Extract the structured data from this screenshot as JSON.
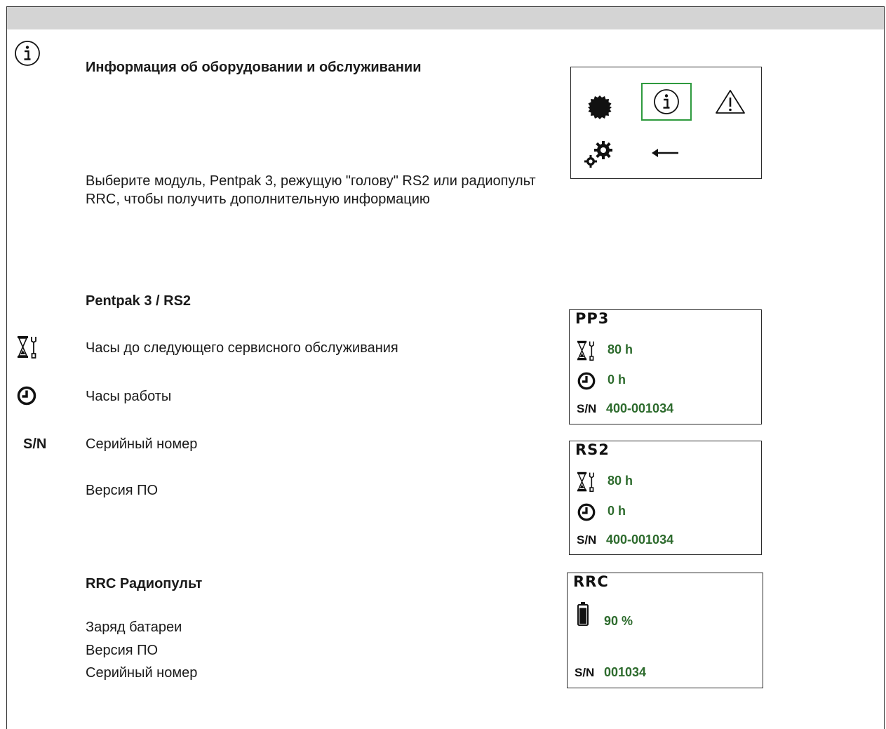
{
  "section_title": "Информация об оборудовании и обслуживании",
  "intro_text": "Выберите модуль, Pentpak 3, режущую \"голову\" RS2 или радиопульт RRC, чтобы получить дополнительную информацию",
  "pentpak_section": {
    "title": "Pentpak 3 / RS2",
    "items": [
      {
        "icon": "hourglass-wrench-icon",
        "label": "Часы до следующего сервисного обслуживания"
      },
      {
        "icon": "clock-icon",
        "label": "Часы работы"
      },
      {
        "icon_text": "S/N",
        "label": "Серийный номер"
      },
      {
        "label": "Версия ПО"
      }
    ]
  },
  "rrc_section": {
    "title": "RRC Радиопульт",
    "items": [
      "Заряд батареи",
      "Версия ПО",
      "Серийный номер"
    ]
  },
  "menu_screen": {
    "icons": [
      "blade-icon",
      "info-icon",
      "warning-icon",
      "settings-gears-icon",
      "back-arrow-icon"
    ],
    "selected": "info-icon",
    "selection_color": "#2e9a3e"
  },
  "displays": {
    "pp3": {
      "header": "PP3",
      "service_hours": "80 h",
      "operating_hours": "0 h",
      "sn_label": "S/N",
      "sn": "400-001034"
    },
    "rs2": {
      "header": "RS2",
      "service_hours": "80 h",
      "operating_hours": "0 h",
      "sn_label": "S/N",
      "sn": "400-001034"
    },
    "rrc": {
      "header": "RRC",
      "battery": "90 %",
      "battery_level": 0.9,
      "sn_label": "S/N",
      "sn": "001034"
    }
  },
  "colors": {
    "value_green": "#2d6b2d",
    "header_bar": "#d4d4d4"
  }
}
